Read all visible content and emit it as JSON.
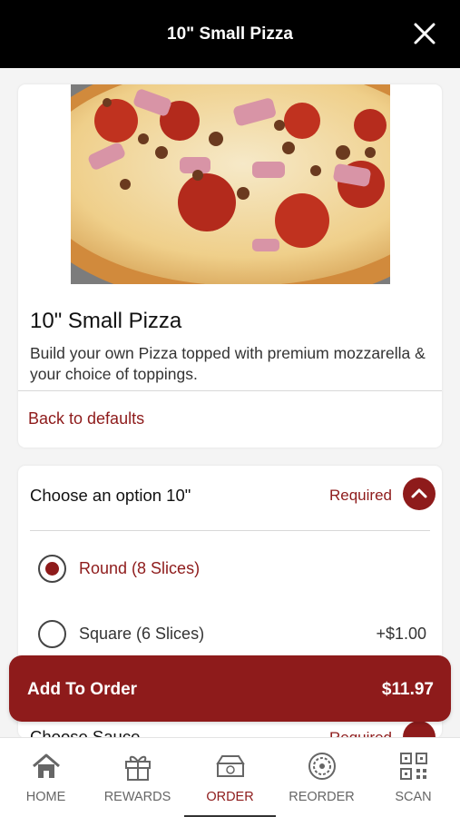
{
  "header": {
    "title": "10\" Small Pizza"
  },
  "item": {
    "name": "10\" Small Pizza",
    "description": "Build your own Pizza topped with premium mozzarella & your choice of toppings.",
    "back_to_defaults": "Back to defaults"
  },
  "option_group": {
    "title": "Choose an option 10\"",
    "required_label": "Required",
    "options": [
      {
        "label": "Round (8 Slices)",
        "price": "",
        "selected": true
      },
      {
        "label": "Square (6 Slices)",
        "price": "+$1.00",
        "selected": false
      }
    ]
  },
  "next_group": {
    "title": "Choose Sauce",
    "required_label": "Required"
  },
  "add_to_order": {
    "label": "Add To Order",
    "price": "$11.97"
  },
  "tabs": [
    {
      "label": "HOME",
      "icon": "home-icon",
      "active": false
    },
    {
      "label": "REWARDS",
      "icon": "gift-icon",
      "active": false
    },
    {
      "label": "ORDER",
      "icon": "pizza-box-icon",
      "active": true
    },
    {
      "label": "REORDER",
      "icon": "reorder-icon",
      "active": false
    },
    {
      "label": "SCAN",
      "icon": "qr-code-icon",
      "active": false
    }
  ],
  "colors": {
    "brand": "#8e1b1b",
    "header_bg": "#000000"
  }
}
